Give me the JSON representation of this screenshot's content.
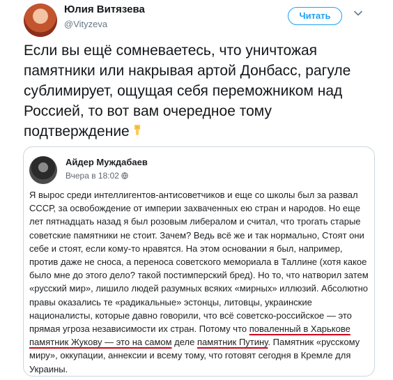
{
  "tweet": {
    "author_name": "Юлия Витязева",
    "author_handle": "@Vityzeva",
    "follow_label": "Читать",
    "text": "Если вы ещё сомневаетесь, что уничтожая памятники или накрывая артой Донбасс, рагуле сублимирует, ощущая себя переможником над Россией, то вот вам очередное тому подтверждение"
  },
  "embedded_post": {
    "author_name": "Айдер Муждабаев",
    "timestamp": "Вчера в 18:02",
    "text_before": "Я вырос среди интеллигентов-антисоветчиков и еще со школы был за развал СССР, за освобождение от империи захваченных ею стран и народов. Но еще лет пятнадцать назад я был розовым либералом и считал, что трогать старые советские памятники не стоит. Зачем? Ведь всё же и так нормально, Стоят они себе и стоят, если кому-то нравятся. На этом основании я был, например, против даже не сноса, а переноса советского мемориала в Таллине (хотя какое было мне до этого дело? такой постимперский бред). Но то, что натворил затем «русский мир», лишило людей разумных всяких «мирных» иллюзий. Абсолютно правы оказались те «радикальные» эстонцы, литовцы, украинские националисты, которые давно говорили, что всё советско-российское — это прямая угроза независимости их стран. Потому что ",
    "highlight_1": "поваленный в Харькове памятник Жукову — это на самом",
    "text_middle": " деле ",
    "highlight_2": "памятник Путину",
    "text_after": ". Памятник «русскому миру», оккупации, аннексии и всему тому, что готовят сегодня в Кремле для Украины."
  },
  "colors": {
    "accent": "#1da1f2",
    "underline": "#d0021b",
    "border": "#ccd6dd"
  },
  "icons": [
    "chevron-down-icon",
    "pointing-down-emoji-icon",
    "globe-icon"
  ]
}
